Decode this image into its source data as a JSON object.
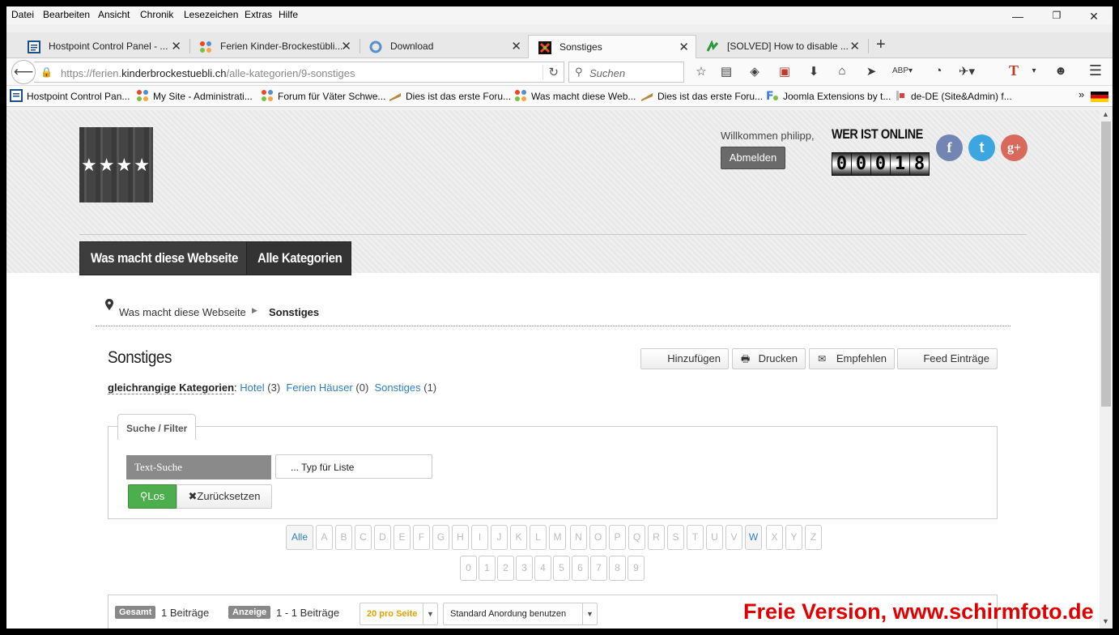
{
  "menubar": {
    "items": [
      "Datei",
      "Bearbeiten",
      "Ansicht",
      "Chronik",
      "Lesezeichen",
      "Extras",
      "Hilfe"
    ]
  },
  "window_controls": {
    "minimize": "—",
    "restore": "❐",
    "close": "✕"
  },
  "tabs": [
    {
      "label": "Hostpoint Control Panel - ...",
      "icon": "hostpoint-icon"
    },
    {
      "label": "Ferien Kinder-Brockestübli...",
      "icon": "joomla-icon"
    },
    {
      "label": "Download",
      "icon": "download-page-icon"
    },
    {
      "label": "Sonstiges",
      "icon": "site-favicon",
      "active": true
    },
    {
      "label": "[SOLVED] How to disable ...",
      "icon": "forum-icon"
    }
  ],
  "new_tab": "+",
  "navbar": {
    "url_prefix": "https://ferien.",
    "url_domain": "kinderbrockestuebli.ch",
    "url_path": "/alle-kategorien/9-sonstiges",
    "search_placeholder": "Suchen"
  },
  "bookmarks": [
    {
      "label": "Hostpoint Control Pan...",
      "icon": "hostpoint-icon"
    },
    {
      "label": "My Site - Administrati...",
      "icon": "joomla-icon"
    },
    {
      "label": "Forum für Väter Schwe...",
      "icon": "joomla-icon"
    },
    {
      "label": "Dies ist das erste Foru...",
      "icon": "forum-icon"
    },
    {
      "label": "Was macht diese Web...",
      "icon": "joomla-icon"
    },
    {
      "label": "Dies ist das erste Foru...",
      "icon": "forum-icon"
    },
    {
      "label": "Joomla Extensions by t...",
      "icon": "extension-icon"
    },
    {
      "label": "de-DE (Site&Admin) f...",
      "icon": "language-icon"
    }
  ],
  "bookmarks_more": "»",
  "header": {
    "logo_stars": "★★★★",
    "welcome": "Willkommen philipp,",
    "logout_label": "Abmelden",
    "online_title": "WER IST ONLINE",
    "counter_digits": [
      "0",
      "0",
      "0",
      "1",
      "8"
    ],
    "social": [
      {
        "name": "facebook",
        "glyph": "f",
        "color": "#7386b3"
      },
      {
        "name": "twitter",
        "glyph": "t",
        "color": "#3ba6e0"
      },
      {
        "name": "google-plus",
        "glyph": "g+",
        "color": "#d9695c"
      }
    ]
  },
  "mainnav": [
    {
      "label": "Was macht diese Webseite"
    },
    {
      "label": "Alle Kategorien"
    }
  ],
  "breadcrumb": {
    "home": "Was macht diese Webseite",
    "current": "Sonstiges"
  },
  "category": {
    "title": "Sonstiges",
    "actions": [
      "Hinzufügen",
      "Drucken",
      "Empfehlen",
      "Feed Einträge"
    ],
    "siblings_label": "gleichrangige Kategorien",
    "siblings": [
      {
        "name": "Hotel",
        "count": "(3)"
      },
      {
        "name": "Ferien Häuser",
        "count": "(0)"
      },
      {
        "name": "Sonstiges",
        "count": "(1)"
      }
    ]
  },
  "filter": {
    "legend": "Suche / Filter",
    "text_search_label": "Text-Suche",
    "input_value": "... Typ für Liste",
    "go_label": "Los",
    "reset_label": "Zurücksetzen"
  },
  "alphabet": [
    "Alle",
    "A",
    "B",
    "C",
    "D",
    "E",
    "F",
    "G",
    "H",
    "I",
    "J",
    "K",
    "L",
    "M",
    "N",
    "O",
    "P",
    "Q",
    "R",
    "S",
    "T",
    "U",
    "V",
    "W",
    "X",
    "Y",
    "Z"
  ],
  "alphabet_active": [
    "Alle",
    "W"
  ],
  "digits": [
    "0",
    "1",
    "2",
    "3",
    "4",
    "5",
    "6",
    "7",
    "8",
    "9"
  ],
  "list": {
    "total_badge": "Gesamt",
    "total_text": "1 Beiträge",
    "display_badge": "Anzeige",
    "display_text": "1 - 1 Beiträge",
    "per_page": "20 pro Seite",
    "ordering": "Standard Anordung benutzen"
  },
  "watermark": "Freie Version, www.schirmfoto.de",
  "colors": {
    "link": "#2f7ec2",
    "go_button": "#4cae4c",
    "watermark": "#e00000",
    "per_page_text": "#e6a000"
  }
}
